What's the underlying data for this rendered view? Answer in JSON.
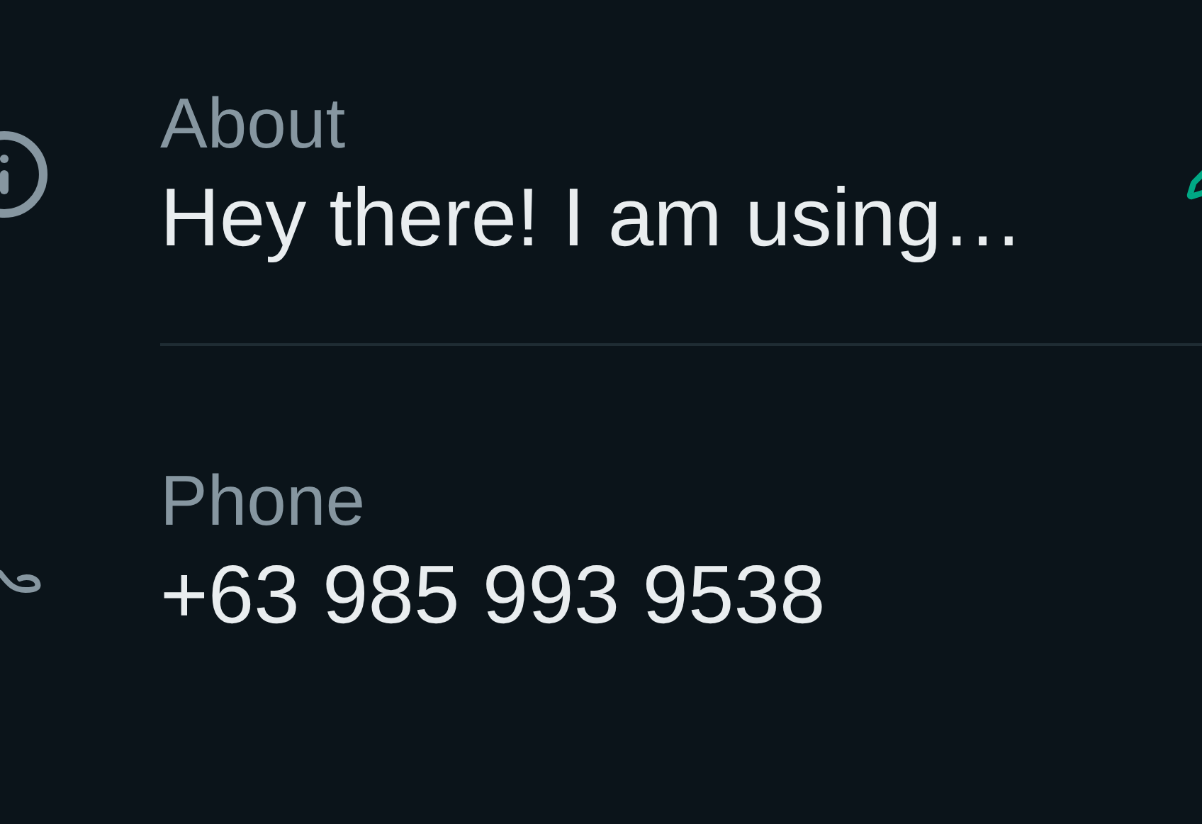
{
  "about": {
    "label": "About",
    "value": "Hey there! I am using…"
  },
  "phone": {
    "label": "Phone",
    "value": "+63 985 993 9538"
  }
}
